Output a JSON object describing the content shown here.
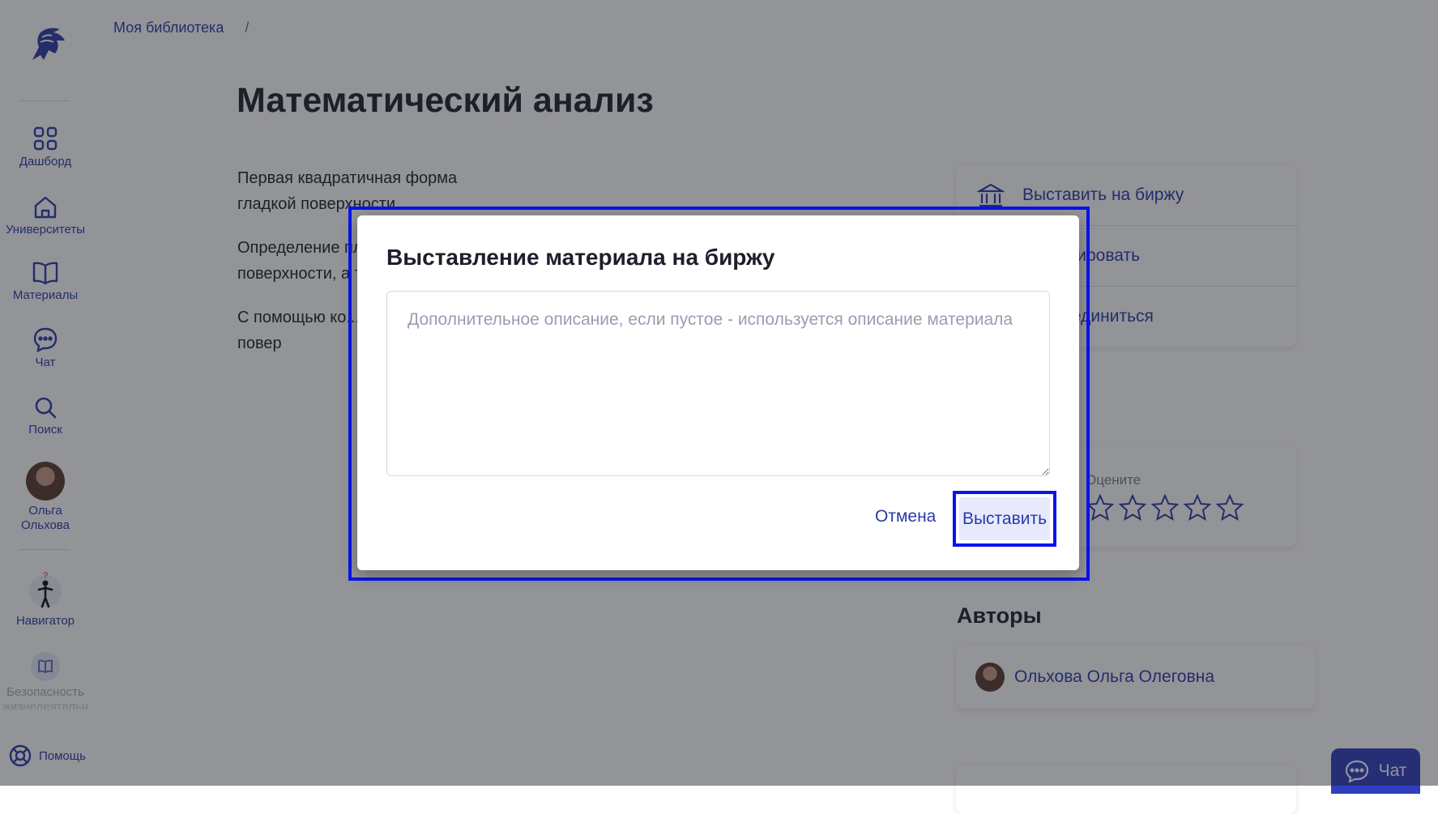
{
  "sidebar": {
    "logo_icon": "helmet-logo-icon",
    "items": [
      {
        "label": "Дашборд",
        "icon": "grid-icon"
      },
      {
        "label": "Университеты",
        "icon": "home-icon"
      },
      {
        "label": "Материалы",
        "icon": "book-open-icon"
      },
      {
        "label": "Чат",
        "icon": "chat-bubble-icon"
      },
      {
        "label": "Поиск",
        "icon": "search-icon"
      }
    ],
    "user": {
      "first_name": "Ольга",
      "last_name": "Ольхова"
    },
    "navigator_label": "Навигатор",
    "course_label_line1": "Безопасность",
    "course_label_line2": "жизнедеятельн",
    "help_label": "Помощь"
  },
  "breadcrumb": {
    "items": [
      "Моя библиотека"
    ],
    "separator": "/"
  },
  "page": {
    "title": "Математический анализ",
    "description": [
      "Первая квадратичная форма гладкой поверхности",
      "Определение площади поверхности, а также ...",
      "С помощью ко... площадь пове... повер"
    ]
  },
  "actions": [
    {
      "label": "Выставить на биржу",
      "icon": "bank-icon"
    },
    {
      "label": "Редактировать",
      "icon": "edit-icon"
    },
    {
      "label": "Присоединиться",
      "icon": "join-icon"
    }
  ],
  "rating": {
    "label": "Оцените",
    "stars_total": 5,
    "stars_filled": 0
  },
  "authors": {
    "title": "Авторы",
    "list": [
      {
        "name": "Ольхова Ольга Олеговна"
      }
    ]
  },
  "chat_button": {
    "label": "Чат"
  },
  "dialog": {
    "title": "Выставление материала на биржу",
    "description_value": "",
    "description_placeholder": "Дополнительное описание, если пустое - используется описание материала",
    "cancel_label": "Отмена",
    "submit_label": "Выставить"
  },
  "colors": {
    "accent": "#2a3aa8",
    "highlight": "#0a12f0",
    "chat": "#2f3fbd"
  }
}
